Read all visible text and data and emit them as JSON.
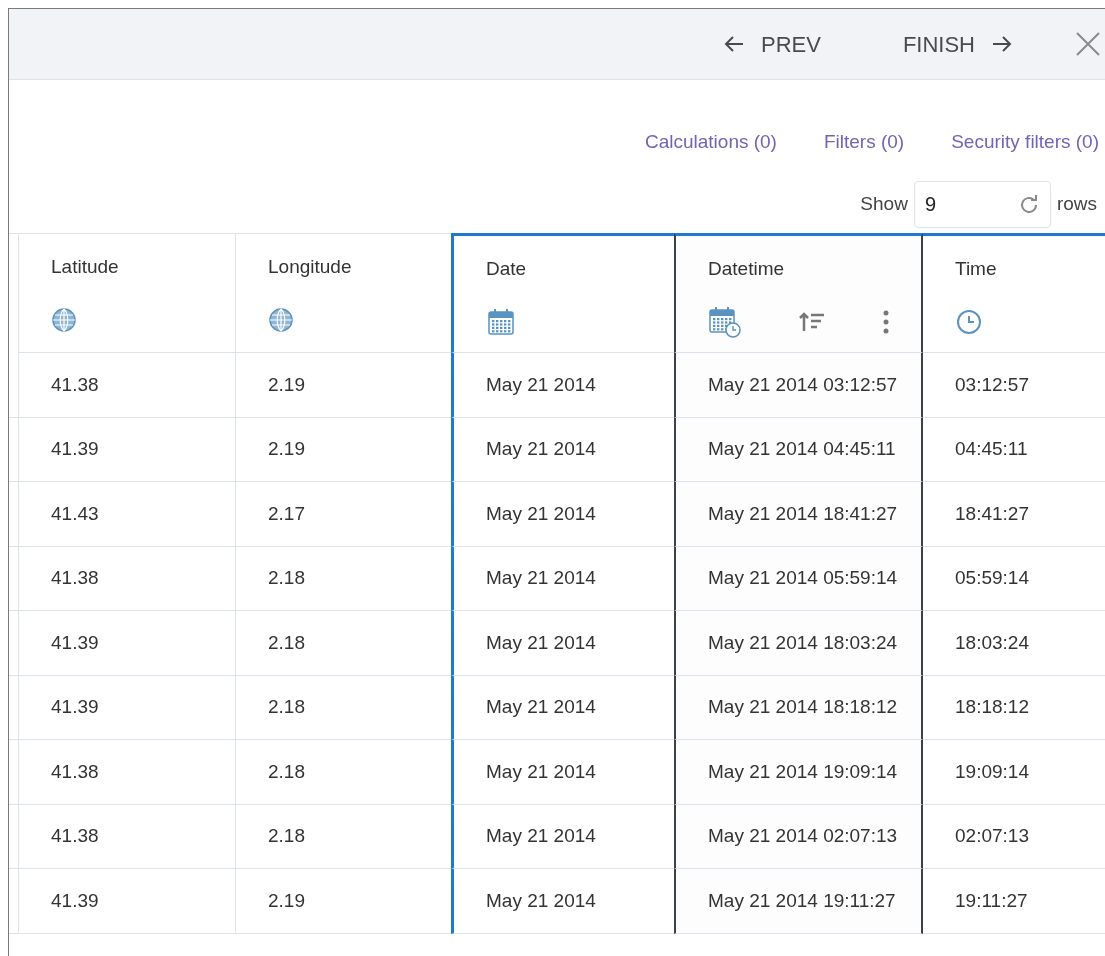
{
  "toolbar": {
    "prev": "PREV",
    "finish": "FINISH"
  },
  "links": [
    "Calculations (0)",
    "Filters (0)",
    "Security filters (0)"
  ],
  "show_rows": {
    "before": "Show",
    "value": "9",
    "after": "rows"
  },
  "table": {
    "columns": [
      {
        "label": "Latitude",
        "kind": "geo",
        "selected": false,
        "active": false
      },
      {
        "label": "Longitude",
        "kind": "geo",
        "selected": false,
        "active": false
      },
      {
        "label": "Date",
        "kind": "date",
        "selected": true,
        "active": false
      },
      {
        "label": "Datetime",
        "kind": "datetime",
        "selected": true,
        "active": true
      },
      {
        "label": "Time",
        "kind": "time",
        "selected": true,
        "active": false
      }
    ],
    "rows": [
      [
        "41.38",
        "2.19",
        "May 21 2014",
        "May 21 2014 03:12:57",
        "03:12:57"
      ],
      [
        "41.39",
        "2.19",
        "May 21 2014",
        "May 21 2014 04:45:11",
        "04:45:11"
      ],
      [
        "41.43",
        "2.17",
        "May 21 2014",
        "May 21 2014 18:41:27",
        "18:41:27"
      ],
      [
        "41.38",
        "2.18",
        "May 21 2014",
        "May 21 2014 05:59:14",
        "05:59:14"
      ],
      [
        "41.39",
        "2.18",
        "May 21 2014",
        "May 21 2014 18:03:24",
        "18:03:24"
      ],
      [
        "41.39",
        "2.18",
        "May 21 2014",
        "May 21 2014 18:18:12",
        "18:18:12"
      ],
      [
        "41.38",
        "2.18",
        "May 21 2014",
        "May 21 2014 19:09:14",
        "19:09:14"
      ],
      [
        "41.38",
        "2.18",
        "May 21 2014",
        "May 21 2014 02:07:13",
        "02:07:13"
      ],
      [
        "41.39",
        "2.19",
        "May 21 2014",
        "May 21 2014 19:11:27",
        "19:11:27"
      ]
    ]
  }
}
